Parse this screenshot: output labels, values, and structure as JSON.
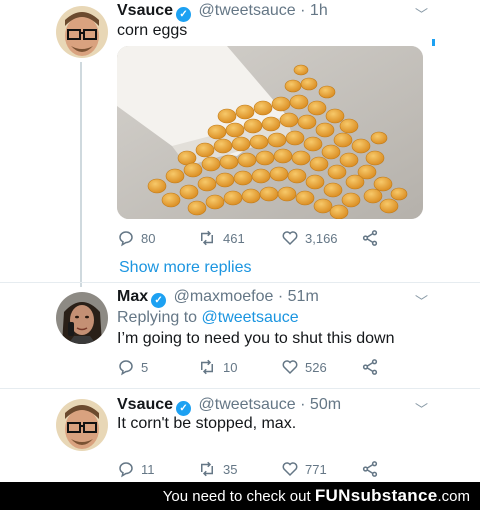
{
  "tweet1": {
    "name": "Vsauce",
    "handle": "@tweetsauce",
    "time": "· 1h",
    "text": "corn eggs",
    "replies": "80",
    "retweets": "461",
    "likes": "3,166"
  },
  "show_more": "Show more replies",
  "tweet2": {
    "name": "Max",
    "handle": "@maxmoefoe",
    "time": "· 51m",
    "replying_label": "Replying to",
    "replying_mention": "@tweetsauce",
    "text": "I’m going to need  you to shut this down",
    "replies": "5",
    "retweets": "10",
    "likes": "526"
  },
  "tweet3": {
    "name": "Vsauce",
    "handle": "@tweetsauce",
    "time": "· 50m",
    "text": "It corn't be stopped, max.",
    "replies": "11",
    "retweets": "35",
    "likes": "771"
  },
  "footer": {
    "text": "You need to check out ",
    "brand_a": "FUN",
    "brand_b": "substance",
    "brand_c": ".com"
  },
  "colors": {
    "link": "#1b95e0",
    "verified": "#1da1f2",
    "muted": "#657786"
  }
}
